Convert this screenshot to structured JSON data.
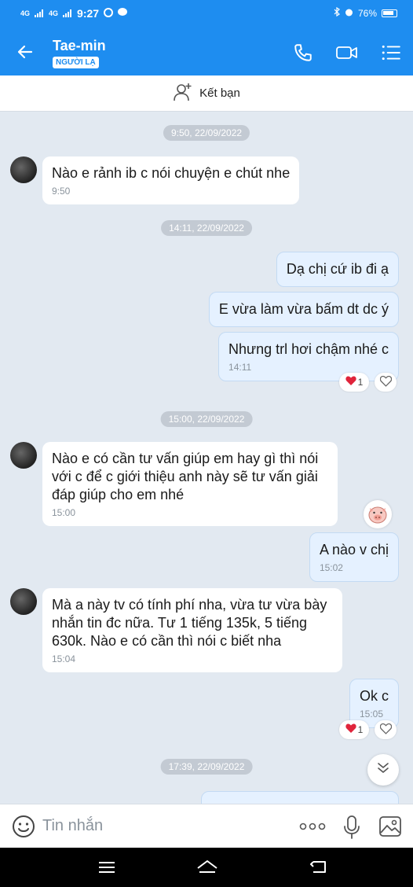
{
  "status": {
    "time": "9:27",
    "signal1": "4G",
    "signal2": "4G",
    "battery": "76%"
  },
  "header": {
    "contact_name": "Tae-min",
    "stranger_badge": "NGƯỜI LẠ"
  },
  "add_friend": {
    "label": "Kết bạn"
  },
  "messages": [
    {
      "type": "timestamp",
      "text": "9:50, 22/09/2022"
    },
    {
      "type": "in",
      "lines": [
        "Nào e rảnh ib c nói chuyện e chút nhe"
      ],
      "time": "9:50"
    },
    {
      "type": "timestamp",
      "text": "14:11, 22/09/2022"
    },
    {
      "type": "out",
      "lines": [
        "Dạ chị cứ ib đi ạ"
      ]
    },
    {
      "type": "out",
      "lines": [
        "E vừa làm vừa bấm dt dc ý"
      ]
    },
    {
      "type": "out",
      "lines": [
        "Nhưng trl hơi chậm nhé c"
      ],
      "time": "14:11",
      "reaction_count": "1"
    },
    {
      "type": "timestamp",
      "text": "15:00, 22/09/2022"
    },
    {
      "type": "in",
      "lines": [
        "Nào e có cần tư vấn giúp em hay gì thì nói",
        "với c để c giới thiệu anh này sẽ tư vấn giải",
        "đáp giúp cho em nhé"
      ],
      "time": "15:00"
    },
    {
      "type": "out",
      "lines": [
        "A nào v chị"
      ],
      "time": "15:02"
    },
    {
      "type": "in",
      "lines": [
        "Mà a này tv có tính phí nha, vừa tư vừa bày",
        "nhắn tin đc nữa. Tư 1 tiếng 135k, 5 tiếng",
        "630k. Nào e có cần thì nói c biết nha"
      ],
      "time": "15:04"
    },
    {
      "type": "out",
      "lines": [
        "Ok c"
      ],
      "time": "15:05",
      "reaction_count": "1"
    },
    {
      "type": "timestamp",
      "text": "17:39, 22/09/2022"
    }
  ],
  "composer": {
    "placeholder": "Tin nhắn"
  },
  "icons": {
    "back": "arrow-left-icon",
    "call": "phone-icon",
    "video": "video-camera-icon",
    "menu": "list-menu-icon",
    "add_friend": "add-user-icon",
    "emoji": "emoji-icon",
    "more": "more-dots-icon",
    "mic": "microphone-icon",
    "image": "image-icon",
    "heart": "heart-icon",
    "sticker": "pig-sticker-icon",
    "scroll": "chevron-down-icon"
  },
  "colors": {
    "brand": "#1e8df0",
    "chat_bg": "#e2e9f1",
    "outgoing_bubble": "#e5f1ff",
    "heart": "#e0243b"
  }
}
